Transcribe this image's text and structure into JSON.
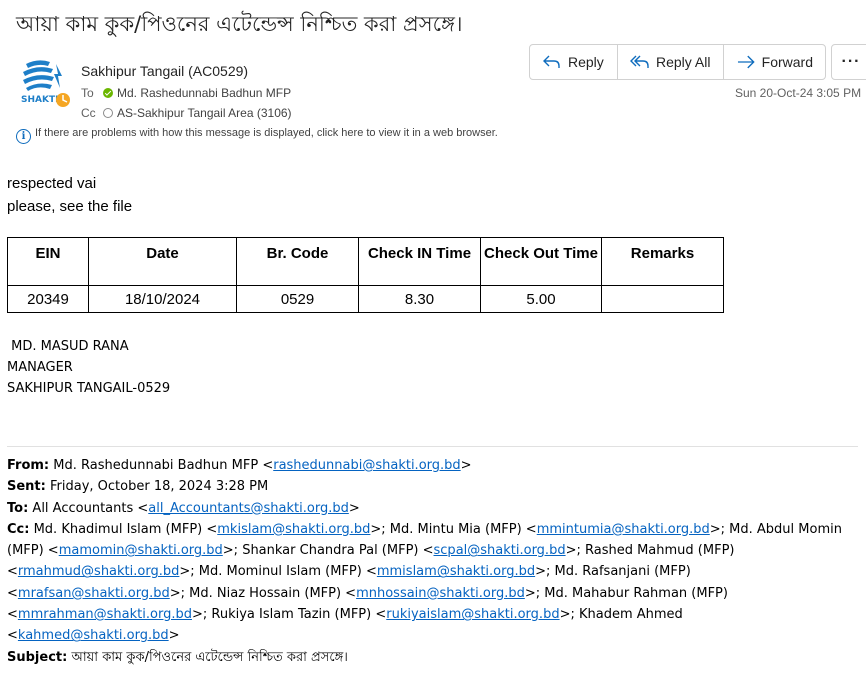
{
  "message": {
    "subject": "আয়া কাম কুক/পিওনের এটেন্ডেন্স নিশ্চিত করা প্রসঙ্গে।",
    "sender": "Sakhipur Tangail (AC0529)",
    "to_label": "To",
    "to_name": "Md. Rashedunnabi Badhun MFP",
    "cc_label": "Cc",
    "cc_name": "AS-Sakhipur Tangail Area (3106)",
    "date": "Sun 20-Oct-24 3:05 PM",
    "info_text": "If there are problems with how this message is displayed, click here to view it in a web browser.",
    "logo_text": "SHAKTI"
  },
  "actions": {
    "reply": "Reply",
    "reply_all": "Reply All",
    "forward": "Forward",
    "more": "···"
  },
  "body": {
    "line1": "respected vai",
    "line2": "please, see the file"
  },
  "table": {
    "headers": [
      "EIN",
      "Date",
      "Br. Code",
      "Check IN Time",
      "Check Out Time",
      "Remarks"
    ],
    "rows": [
      [
        "20349",
        "18/10/2024",
        "0529",
        "8.30",
        "5.00",
        ""
      ]
    ]
  },
  "signature": {
    "name": "MD. MASUD RANA",
    "title": "MANAGER",
    "branch": "SAKHIPUR TANGAIL-0529"
  },
  "forwarded": {
    "from_label": "From:",
    "from_name": "Md. Rashedunnabi Badhun MFP <",
    "from_email": "rashedunnabi@shakti.org.bd",
    "from_end": ">",
    "sent_label": "Sent:",
    "sent_value": "Friday, October 18, 2024 3:28 PM",
    "to_label": "To:",
    "to_name": "All Accountants <",
    "to_email": "all_Accountants@shakti.org.bd",
    "to_end": ">",
    "cc_label": "Cc:",
    "cc_list": [
      {
        "name": "Md. Khadimul Islam (MFP) <",
        "email": "mkislam@shakti.org.bd",
        "sep": ">; "
      },
      {
        "name": "Md. Mintu Mia (MFP) <",
        "email": "mmintumia@shakti.org.bd",
        "sep": ">; "
      },
      {
        "name": "Md. Abdul Momin (MFP) <",
        "email": "mamomin@shakti.org.bd",
        "sep": ">; "
      },
      {
        "name": "Shankar Chandra Pal (MFP) <",
        "email": "scpal@shakti.org.bd",
        "sep": ">; "
      },
      {
        "name": "Rashed Mahmud (MFP) <",
        "email": "rmahmud@shakti.org.bd",
        "sep": ">; "
      },
      {
        "name": "Md. Mominul Islam (MFP) <",
        "email": "mmislam@shakti.org.bd",
        "sep": ">; "
      },
      {
        "name": "Md. Rafsanjani (MFP) <",
        "email": "mrafsan@shakti.org.bd",
        "sep": ">; "
      },
      {
        "name": "Md. Niaz Hossain (MFP) <",
        "email": "mnhossain@shakti.org.bd",
        "sep": ">; "
      },
      {
        "name": "Md. Mahabur Rahman (MFP) <",
        "email": "mmrahman@shakti.org.bd",
        "sep": ">; "
      },
      {
        "name": "Rukiya Islam Tazin (MFP) <",
        "email": "rukiyaislam@shakti.org.bd",
        "sep": ">; "
      },
      {
        "name": "Khadem Ahmed <",
        "email": "kahmed@shakti.org.bd",
        "sep": ">"
      }
    ],
    "subject_label": "Subject:",
    "subject_value": "আয়া কাম কুক/পিওনের এটেন্ডেন্স নিশ্চিত করা প্রসঙ্গে।"
  },
  "colors": {
    "accent": "#0f6cbd",
    "presence": "#6bb700",
    "link": "#0563c1",
    "logo_blue": "#1e7fc8",
    "logo_orange": "#f5a623"
  }
}
